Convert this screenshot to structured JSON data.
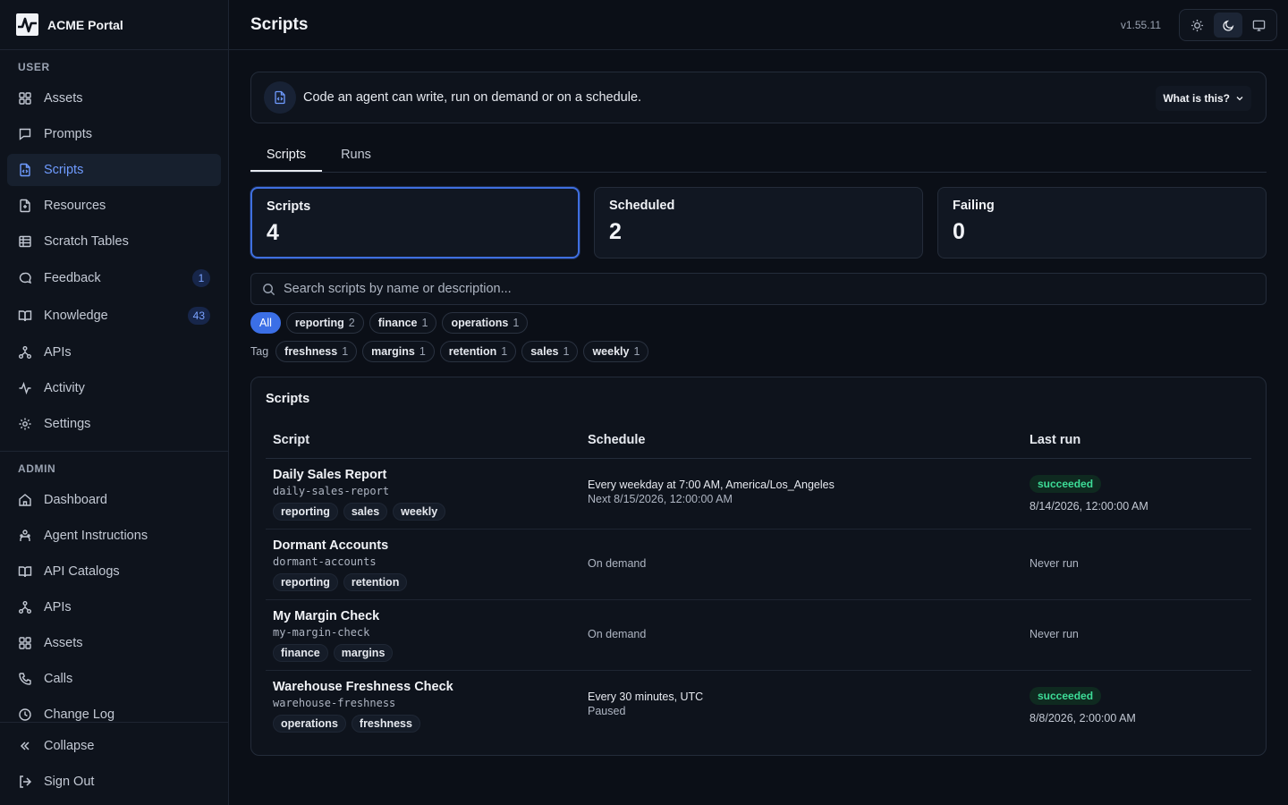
{
  "app": {
    "name": "ACME Portal",
    "version": "v1.55.11"
  },
  "sidebar": {
    "user_label": "USER",
    "user_items": [
      {
        "label": "Assets",
        "icon": "grid-icon"
      },
      {
        "label": "Prompts",
        "icon": "message-icon"
      },
      {
        "label": "Scripts",
        "icon": "file-code-icon",
        "active": true
      },
      {
        "label": "Resources",
        "icon": "file-icon"
      },
      {
        "label": "Scratch Tables",
        "icon": "table-icon"
      },
      {
        "label": "Feedback",
        "icon": "chat-icon",
        "count": "1"
      },
      {
        "label": "Knowledge",
        "icon": "book-icon",
        "count": "43"
      },
      {
        "label": "APIs",
        "icon": "network-icon"
      },
      {
        "label": "Activity",
        "icon": "activity-icon"
      },
      {
        "label": "Settings",
        "icon": "gear-icon"
      }
    ],
    "admin_label": "ADMIN",
    "admin_items": [
      {
        "label": "Dashboard",
        "icon": "home-icon"
      },
      {
        "label": "Agent Instructions",
        "icon": "bot-icon"
      },
      {
        "label": "API Catalogs",
        "icon": "book-icon"
      },
      {
        "label": "APIs",
        "icon": "network-icon"
      },
      {
        "label": "Assets",
        "icon": "grid-icon"
      },
      {
        "label": "Calls",
        "icon": "phone-icon"
      },
      {
        "label": "Change Log",
        "icon": "clock-icon"
      }
    ],
    "collapse_label": "Collapse",
    "signout_label": "Sign Out"
  },
  "header": {
    "title": "Scripts"
  },
  "info": {
    "text": "Code an agent can write, run on demand or on a schedule.",
    "button": "What is this?"
  },
  "tabs": [
    "Scripts",
    "Runs"
  ],
  "stats": [
    {
      "label": "Scripts",
      "value": "4"
    },
    {
      "label": "Scheduled",
      "value": "2"
    },
    {
      "label": "Failing",
      "value": "0"
    }
  ],
  "search": {
    "placeholder": "Search scripts by name or description..."
  },
  "category_filters": [
    {
      "label": "All",
      "count": ""
    },
    {
      "label": "reporting",
      "count": "2"
    },
    {
      "label": "finance",
      "count": "1"
    },
    {
      "label": "operations",
      "count": "1"
    }
  ],
  "tag_filter_label": "Tag",
  "tag_filters": [
    {
      "label": "freshness",
      "count": "1"
    },
    {
      "label": "margins",
      "count": "1"
    },
    {
      "label": "retention",
      "count": "1"
    },
    {
      "label": "sales",
      "count": "1"
    },
    {
      "label": "weekly",
      "count": "1"
    }
  ],
  "table": {
    "title": "Scripts",
    "columns": [
      "Script",
      "Schedule",
      "Last run"
    ],
    "rows": [
      {
        "name": "Daily Sales Report",
        "slug": "daily-sales-report",
        "tags": [
          "reporting",
          "sales",
          "weekly"
        ],
        "schedule": "Every weekday at 7:00 AM, America/Los_Angeles",
        "schedule_sub": "Next 8/15/2026, 12:00:00 AM",
        "status": "succeeded",
        "last_run": "8/14/2026, 12:00:00 AM"
      },
      {
        "name": "Dormant Accounts",
        "slug": "dormant-accounts",
        "tags": [
          "reporting",
          "retention"
        ],
        "schedule": "On demand",
        "schedule_sub": "",
        "status": "",
        "last_run": "Never run"
      },
      {
        "name": "My Margin Check",
        "slug": "my-margin-check",
        "tags": [
          "finance",
          "margins"
        ],
        "schedule": "On demand",
        "schedule_sub": "",
        "status": "",
        "last_run": "Never run"
      },
      {
        "name": "Warehouse Freshness Check",
        "slug": "warehouse-freshness",
        "tags": [
          "operations",
          "freshness"
        ],
        "schedule": "Every 30 minutes, UTC",
        "schedule_sub": "Paused",
        "status": "succeeded",
        "last_run": "8/8/2026, 2:00:00 AM"
      }
    ]
  },
  "colors": {
    "accent": "#3b6fe6",
    "success": "#3ddc97",
    "background": "#0b0f17"
  }
}
